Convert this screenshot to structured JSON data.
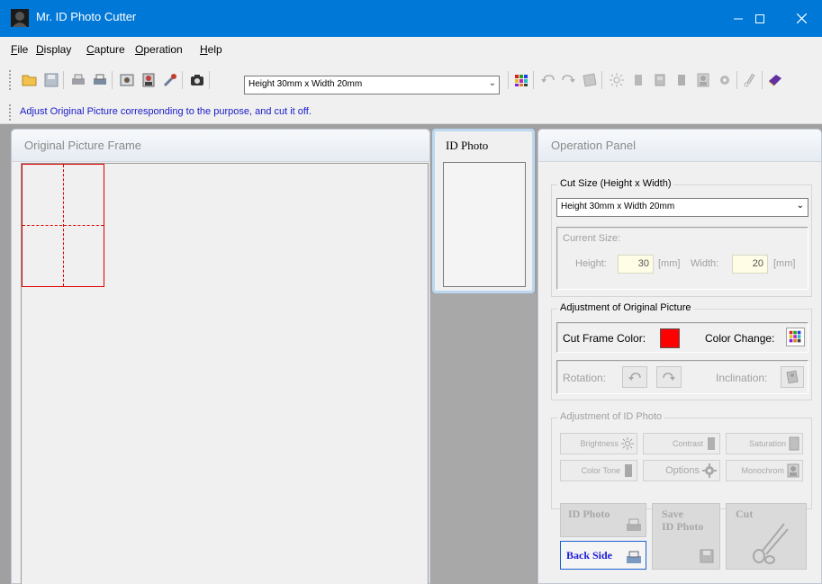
{
  "window": {
    "title": "Mr. ID Photo Cutter"
  },
  "menu": {
    "items": [
      {
        "label": "File",
        "key": "F"
      },
      {
        "label": "Display",
        "key": "D"
      },
      {
        "label": "Capture",
        "key": "C"
      },
      {
        "label": "Operation",
        "key": "O"
      },
      {
        "label": "Help",
        "key": "H"
      }
    ]
  },
  "toolbar": {
    "size_selected": "Height 30mm x Width 20mm"
  },
  "hint": "Adjust Original Picture corresponding to the purpose, and cut it off.",
  "original_panel": {
    "title": "Original Picture Frame"
  },
  "id_panel": {
    "title": "ID Photo"
  },
  "op_panel": {
    "title": "Operation Panel",
    "cut_size": {
      "group_title": "Cut Size (Height x Width)",
      "selected": "Height 30mm x Width 20mm",
      "current_size_label": "Current Size:",
      "height_label": "Height:",
      "height_value": "30",
      "width_label": "Width:",
      "width_value": "20",
      "unit1": "[mm]",
      "unit2": "[mm]"
    },
    "adjust_original": {
      "group_title": "Adjustment of Original Picture",
      "cut_frame_color_label": "Cut Frame Color:",
      "cut_frame_color": "#ff0000",
      "color_change_label": "Color Change:",
      "rotation_label": "Rotation:",
      "inclination_label": "Inclination:"
    },
    "adjust_id": {
      "group_title": "Adjustment of ID Photo",
      "brightness": "Brightness",
      "contrast": "Contrast",
      "saturation": "Saturation",
      "color_tone": "Color Tone",
      "options": "Options",
      "monochrome": "Monochrom"
    },
    "buttons": {
      "id_photo": "ID Photo",
      "save_line1": "Save",
      "save_line2": "ID Photo",
      "cut": "Cut",
      "back_side": "Back Side"
    }
  },
  "colors": {
    "titlebar": "#0078d7",
    "hint_text": "#1a1acc",
    "cut_frame": "#e00000"
  }
}
